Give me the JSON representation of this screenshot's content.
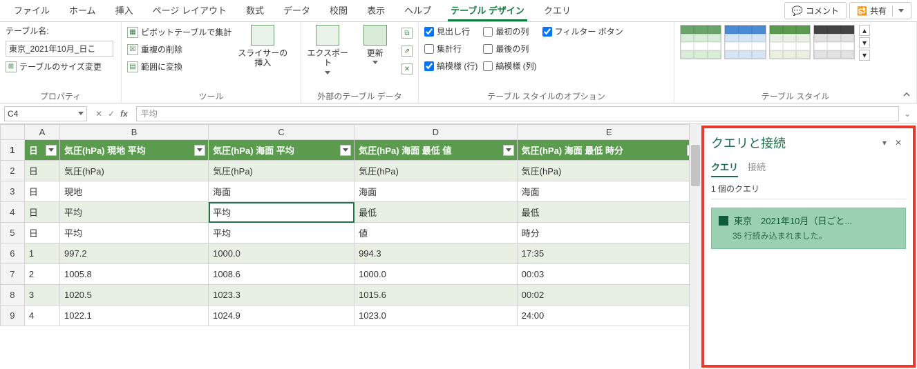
{
  "tabs": {
    "file": "ファイル",
    "home": "ホーム",
    "insert": "挿入",
    "page_layout": "ページ レイアウト",
    "formulas": "数式",
    "data": "データ",
    "review": "校閲",
    "view": "表示",
    "help": "ヘルプ",
    "table_design": "テーブル デザイン",
    "query": "クエリ"
  },
  "top_right": {
    "comment": "コメント",
    "share": "共有"
  },
  "ribbon": {
    "table_name_label": "テーブル名:",
    "table_name_value": "東京_2021年10月_日こ",
    "resize_table": "テーブルのサイズ変更",
    "group_props": "プロパティ",
    "pivot_summarize": "ピボットテーブルで集計",
    "remove_dup": "重複の削除",
    "convert_range": "範囲に変換",
    "slicer_insert": "スライサーの\n挿入",
    "group_tools": "ツール",
    "export": "エクスポート",
    "refresh": "更新",
    "group_ext": "外部のテーブル データ",
    "header_row": "見出し行",
    "total_row": "集計行",
    "banded_rows": "縞模様 (行)",
    "first_col": "最初の列",
    "last_col": "最後の列",
    "banded_cols": "縞模様 (列)",
    "filter_btn": "フィルター ボタン",
    "group_style_opts": "テーブル スタイルのオプション",
    "group_styles": "テーブル スタイル"
  },
  "name_box": "C4",
  "formula_value": "平均",
  "columns": {
    "A": "A",
    "B": "B",
    "C": "C",
    "D": "D",
    "E": "E"
  },
  "header_row_labels": {
    "A": "日",
    "B": "気圧(hPa) 現地 平均",
    "C": "気圧(hPa) 海面 平均",
    "D": "気圧(hPa) 海面 最低 値",
    "E": "気圧(hPa) 海面 最低 時分"
  },
  "rows": [
    {
      "n": "2",
      "A": "日",
      "B": "気圧(hPa)",
      "C": "気圧(hPa)",
      "D": "気圧(hPa)",
      "E": "気圧(hPa)"
    },
    {
      "n": "3",
      "A": "日",
      "B": "現地",
      "C": "海面",
      "D": "海面",
      "E": "海面"
    },
    {
      "n": "4",
      "A": "日",
      "B": "平均",
      "C": "平均",
      "D": "最低",
      "E": "最低"
    },
    {
      "n": "5",
      "A": "日",
      "B": "平均",
      "C": "平均",
      "D": "値",
      "E": "時分"
    },
    {
      "n": "6",
      "A": "1",
      "B": "997.2",
      "C": "1000.0",
      "D": "994.3",
      "E": "17:35"
    },
    {
      "n": "7",
      "A": "2",
      "B": "1005.8",
      "C": "1008.6",
      "D": "1000.0",
      "E": "00:03"
    },
    {
      "n": "8",
      "A": "3",
      "B": "1020.5",
      "C": "1023.3",
      "D": "1015.6",
      "E": "00:02"
    },
    {
      "n": "9",
      "A": "4",
      "B": "1022.1",
      "C": "1024.9",
      "D": "1023.0",
      "E": "24:00"
    }
  ],
  "pane": {
    "title": "クエリと接続",
    "tab_queries": "クエリ",
    "tab_connections": "接続",
    "count": "1 個のクエリ",
    "item_title": "東京　2021年10月（日ごと...",
    "item_sub": "35 行読み込まれました。"
  }
}
